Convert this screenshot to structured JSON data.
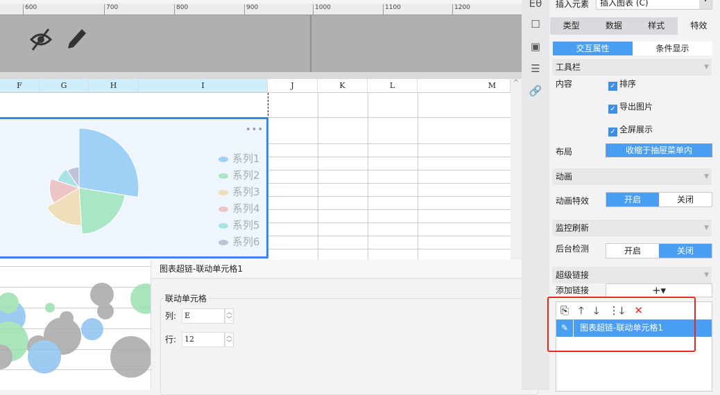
{
  "ruler": {
    "ticks": [
      "600",
      "700",
      "800",
      "900",
      "1000",
      "1100",
      "1200"
    ]
  },
  "overlay_icons": [
    "eye-slash-icon",
    "pencil-icon"
  ],
  "columns": [
    "F",
    "G",
    "H",
    "I",
    "J",
    "K",
    "L",
    "M"
  ],
  "chart_data": {
    "type": "pie",
    "variant": "nightingale-rose",
    "series": [
      "系列1",
      "系列2",
      "系列3",
      "系列4",
      "系列5",
      "系列6"
    ],
    "values": [
      95,
      74,
      60,
      47,
      36,
      33
    ],
    "colors": [
      "#9fd0f5",
      "#a9e6c6",
      "#eedfb8",
      "#eec5c7",
      "#a9e3e6",
      "#bfc3d9"
    ],
    "legend_position": "right",
    "menu_icon": "more-icon"
  },
  "bubble_chart": {
    "colors": [
      "#8ec3f0",
      "#9be0b0",
      "#a8a8a8"
    ]
  },
  "dialog": {
    "title": "图表超链-联动单元格1",
    "group": "联动单元格",
    "col_label": "列:",
    "col_value": "E",
    "row_label": "行:",
    "row_value": "12"
  },
  "panel": {
    "insert_label": "插入元素",
    "insert_value": "插入图表 (C)",
    "tabs": [
      "类型",
      "数据",
      "样式",
      "特效"
    ],
    "subtabs": [
      "交互属性",
      "条件显示"
    ],
    "toolbar": {
      "title": "工具栏",
      "content_label": "内容",
      "options": [
        "排序",
        "导出图片",
        "全屏展示"
      ],
      "layout_label": "布局",
      "layout_value": "收缩于抽屉菜单内"
    },
    "animation": {
      "title": "动画",
      "label": "动画特效",
      "on": "开启",
      "off": "关闭"
    },
    "monitor": {
      "title": "监控刷新",
      "label": "后台检测",
      "on": "开启",
      "off": "关闭"
    },
    "hyperlink": {
      "title": "超级链接",
      "add_label": "添加链接",
      "add_button": "+▾",
      "items": [
        "图表超链-联动单元格1"
      ]
    }
  },
  "accent": "#4a9ef1"
}
